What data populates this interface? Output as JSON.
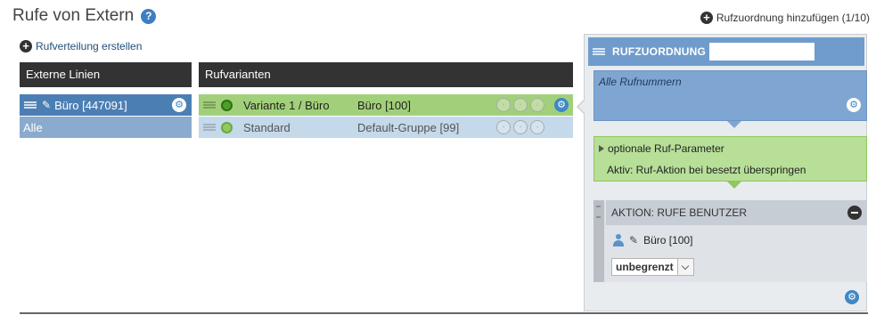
{
  "page": {
    "title": "Rufe von Extern",
    "help_icon": "?"
  },
  "actions": {
    "add_assignment": "Rufzuordnung hinzufügen  (1/10)",
    "create_distribution": "Rufverteilung erstellen"
  },
  "columns": {
    "external_lines": "Externe Linien",
    "variants": "Rufvarianten"
  },
  "external_lines": [
    {
      "label": "Büro [447091]",
      "selected": true
    },
    {
      "label": "Alle",
      "selected": false
    }
  ],
  "variants": [
    {
      "name": "Variante 1 / Büro",
      "group": "Büro [100]",
      "active": true
    },
    {
      "name": "Standard",
      "group": "Default-Gruppe [99]",
      "active": false
    }
  ],
  "panel": {
    "header_title": "RUFZUORDNUNG",
    "header_input_value": "",
    "numbers_label": "Alle Rufnummern",
    "optional_params_label": "optionale Ruf-Parameter",
    "active_note": "Aktiv: Ruf-Aktion bei besetzt überspringen",
    "action_title": "AKTION: RUFE BENUTZER",
    "user_label": "Büro [100]",
    "duration_select_value": "unbegrenzt"
  },
  "colors": {
    "selected_line": "#4b7fb4",
    "active_variant": "#a2d07a",
    "panel_header": "#6f9ccc",
    "accent_blue": "#3f88c5"
  },
  "icons": [
    "help-icon",
    "plus-circle-icon",
    "gear-icon",
    "drag-grip-icon",
    "pencil-icon",
    "status-dot-icon",
    "minus-circle-icon",
    "user-icon",
    "chevron-down-icon"
  ]
}
